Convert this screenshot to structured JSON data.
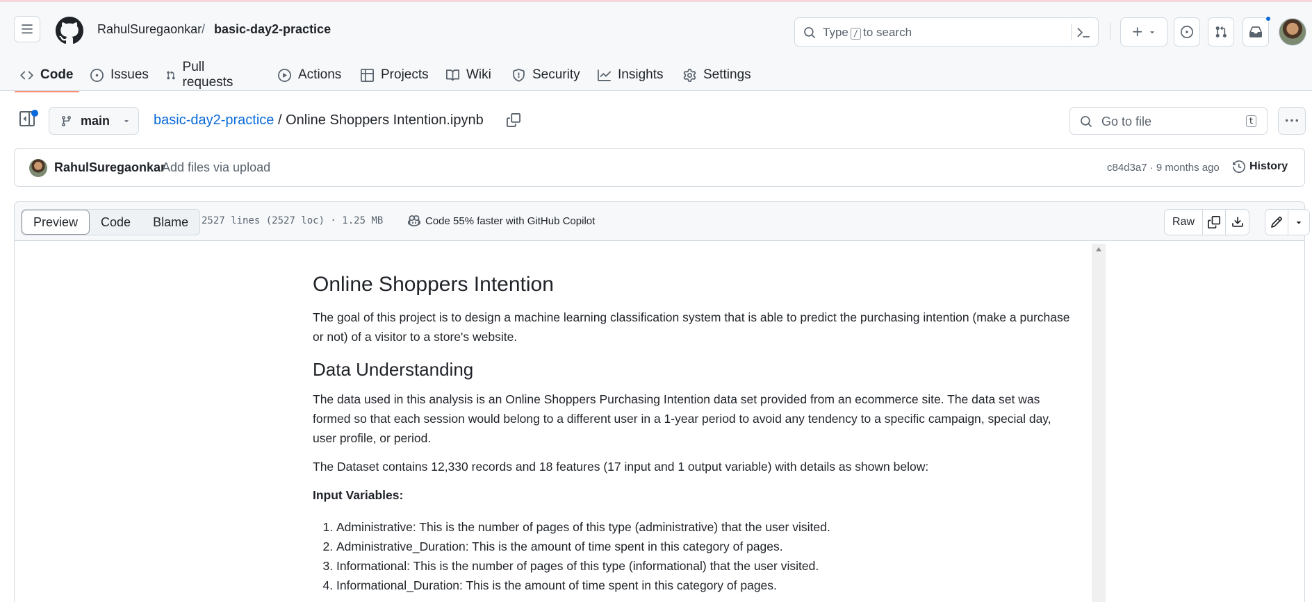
{
  "header": {
    "owner": "RahulSuregaonkar",
    "separator": "/",
    "repo": "basic-day2-practice",
    "search": {
      "prefix": "Type",
      "key": "/",
      "suffix": "to search"
    }
  },
  "tabs": [
    {
      "label": "Code",
      "icon": "code-icon"
    },
    {
      "label": "Issues",
      "icon": "issue-icon"
    },
    {
      "label": "Pull requests",
      "icon": "pull-request-icon"
    },
    {
      "label": "Actions",
      "icon": "play-icon"
    },
    {
      "label": "Projects",
      "icon": "table-icon"
    },
    {
      "label": "Wiki",
      "icon": "book-icon"
    },
    {
      "label": "Security",
      "icon": "shield-icon"
    },
    {
      "label": "Insights",
      "icon": "graph-icon"
    },
    {
      "label": "Settings",
      "icon": "gear-icon"
    }
  ],
  "file_path": {
    "branch": "main",
    "repo_link": "basic-day2-practice",
    "separator": "/",
    "file_name": "Online Shoppers Intention.ipynb",
    "go_to_file_placeholder": "Go to file",
    "go_to_file_key": "t"
  },
  "commit": {
    "author": "RahulSuregaonkar",
    "message": "Add files via upload",
    "hash_time": "c84d3a7 · 9 months ago",
    "history_label": "History"
  },
  "file_header": {
    "views": [
      "Preview",
      "Code",
      "Blame"
    ],
    "stats": "2527 lines (2527 loc) · 1.25 MB",
    "copilot": "Code 55% faster with GitHub Copilot",
    "raw_label": "Raw"
  },
  "article": {
    "title": "Online Shoppers Intention",
    "intro": "The goal of this project is to design a machine learning classification system that is able to predict the purchasing intention (make a purchase or not) of a visitor to a store's website.",
    "section_title": "Data Understanding",
    "para1": "The data used in this analysis is an Online Shoppers Purchasing Intention data set provided from an ecommerce site. The data set was formed so that each session would belong to a different user in a 1-year period to avoid any tendency to a specific campaign, special day, user profile, or period.",
    "para2": "The Dataset contains 12,330 records and 18 features (17 input and 1 output variable) with details as shown below:",
    "input_heading": "Input Variables:",
    "items": [
      "Administrative: This is the number of pages of this type (administrative) that the user visited.",
      "Administrative_Duration: This is the amount of time spent in this category of pages.",
      "Informational: This is the number of pages of this type (informational) that the user visited.",
      "Informational_Duration: This is the amount of time spent in this category of pages."
    ]
  },
  "colors": {
    "accent": "#0969da",
    "tab_underline": "#fd8c73",
    "notification": "#0969da"
  }
}
